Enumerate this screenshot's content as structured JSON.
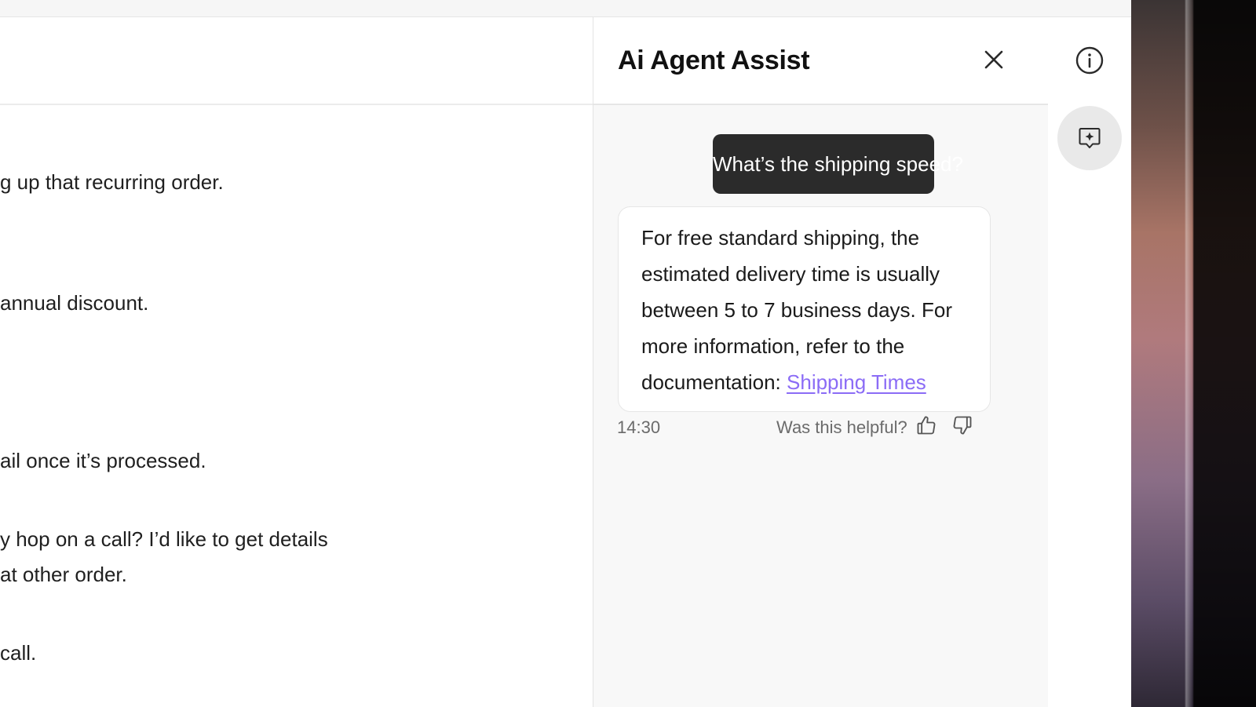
{
  "conversation": {
    "lines": [
      "g up that recurring order.",
      "annual discount.",
      "ail once it’s processed.",
      "y hop on a call? I’d like to get details",
      "at other order.",
      "call."
    ]
  },
  "ai_panel": {
    "title": "Ai Agent Assist",
    "user_message": "What’s the shipping speed?",
    "bot_message_text": "For free standard shipping, the estimated delivery time is usually between 5 to 7 business days. For more information, refer to the documentation: ",
    "bot_link_text": "Shipping Times",
    "timestamp": "14:30",
    "feedback_prompt": "Was this helpful?"
  },
  "icons": {
    "close": "close-icon",
    "thumbs_up": "thumbs-up-icon",
    "thumbs_down": "thumbs-down-icon",
    "info": "info-icon",
    "ai_assist": "ai-sparkle-chat-icon"
  },
  "colors": {
    "user_bubble": "#2b2b2b",
    "link": "#8b6cf6",
    "panel_bg": "#f8f8f8"
  }
}
